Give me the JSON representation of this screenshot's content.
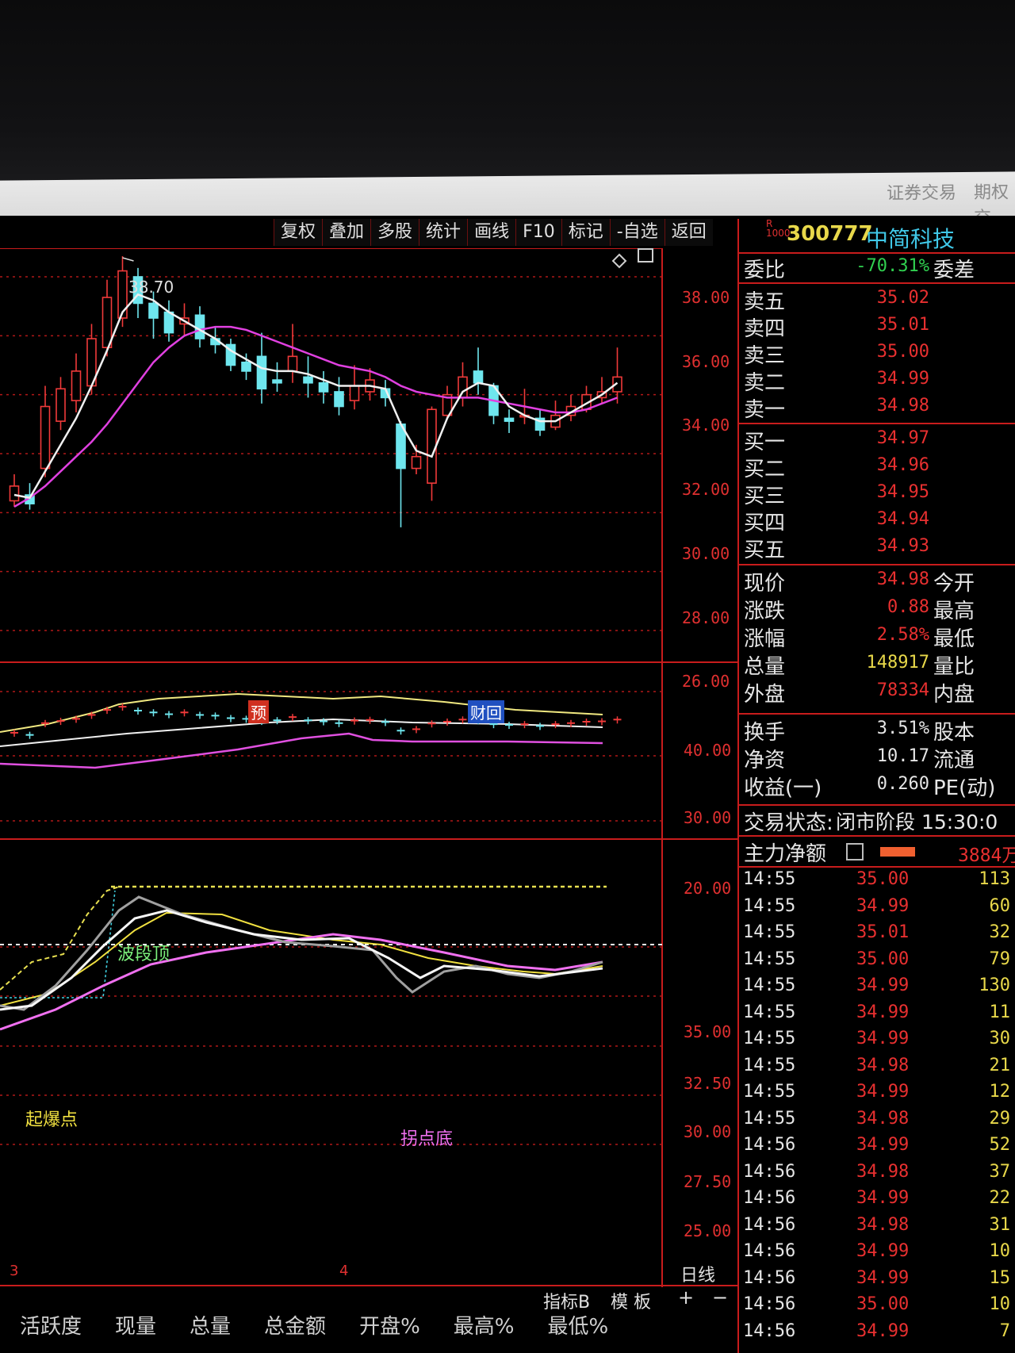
{
  "window_links": [
    "证券交易",
    "期权交"
  ],
  "toolbar": [
    "复权",
    "叠加",
    "多股",
    "统计",
    "画线",
    "F10",
    "标记",
    "-自选",
    "返回"
  ],
  "stock": {
    "badge": "R\n1000",
    "code": "300777",
    "name": "中简科技"
  },
  "weibi": {
    "label": "委比",
    "value": "-70.31%",
    "label2": "委差"
  },
  "asks": [
    {
      "label": "卖五",
      "price": "35.02"
    },
    {
      "label": "卖四",
      "price": "35.01"
    },
    {
      "label": "卖三",
      "price": "35.00"
    },
    {
      "label": "卖二",
      "price": "34.99"
    },
    {
      "label": "卖一",
      "price": "34.98"
    }
  ],
  "bids": [
    {
      "label": "买一",
      "price": "34.97"
    },
    {
      "label": "买二",
      "price": "34.96"
    },
    {
      "label": "买三",
      "price": "34.95"
    },
    {
      "label": "买四",
      "price": "34.94"
    },
    {
      "label": "买五",
      "price": "34.93"
    }
  ],
  "quote": [
    {
      "label": "现价",
      "value": "34.98",
      "label2": "今开"
    },
    {
      "label": "涨跌",
      "value": "0.88",
      "label2": "最高"
    },
    {
      "label": "涨幅",
      "value": "2.58%",
      "label2": "最低"
    },
    {
      "label": "总量",
      "value": "148917",
      "label2": "量比"
    },
    {
      "label": "外盘",
      "value": "78334",
      "label2": "内盘"
    }
  ],
  "stats": [
    {
      "label": "换手",
      "value": "3.51%",
      "label2": "股本"
    },
    {
      "label": "净资",
      "value": "10.17",
      "label2": "流通"
    },
    {
      "label": "收益(一)",
      "value": "0.260",
      "label2": "PE(动)"
    }
  ],
  "status": {
    "label": "交易状态:",
    "value": "闭市阶段 15:30:0"
  },
  "mainflow": {
    "label": "主力净额",
    "value": "3884万"
  },
  "ticks": [
    {
      "t": "14:55",
      "p": "35.00",
      "v": "113"
    },
    {
      "t": "14:55",
      "p": "34.99",
      "v": "60"
    },
    {
      "t": "14:55",
      "p": "35.01",
      "v": "32"
    },
    {
      "t": "14:55",
      "p": "35.00",
      "v": "79"
    },
    {
      "t": "14:55",
      "p": "34.99",
      "v": "130"
    },
    {
      "t": "14:55",
      "p": "34.99",
      "v": "11"
    },
    {
      "t": "14:55",
      "p": "34.99",
      "v": "30"
    },
    {
      "t": "14:55",
      "p": "34.98",
      "v": "21"
    },
    {
      "t": "14:55",
      "p": "34.99",
      "v": "12"
    },
    {
      "t": "14:55",
      "p": "34.98",
      "v": "29"
    },
    {
      "t": "14:56",
      "p": "34.99",
      "v": "52"
    },
    {
      "t": "14:56",
      "p": "34.98",
      "v": "37"
    },
    {
      "t": "14:56",
      "p": "34.99",
      "v": "22"
    },
    {
      "t": "14:56",
      "p": "34.98",
      "v": "31"
    },
    {
      "t": "14:56",
      "p": "34.99",
      "v": "10"
    },
    {
      "t": "14:56",
      "p": "34.99",
      "v": "15"
    },
    {
      "t": "14:56",
      "p": "35.00",
      "v": "10"
    },
    {
      "t": "14:56",
      "p": "34.99",
      "v": "7"
    }
  ],
  "chart_data": {
    "type": "candlestick",
    "price_axis": [
      "38.00",
      "36.00",
      "34.00",
      "32.00",
      "30.00",
      "28.00",
      "26.00"
    ],
    "peak_label": "38.70",
    "markers": [
      "预",
      "财回"
    ],
    "mid_axis": [
      "40.00",
      "30.00",
      "20.00"
    ],
    "lower_axis": [
      "35.00",
      "32.50",
      "30.00",
      "27.50",
      "25.00"
    ],
    "lower_labels": [
      "波段顶",
      "起爆点",
      "拐点底"
    ],
    "period_marks": [
      "3",
      "4"
    ],
    "period": "日线",
    "ylim": [
      26,
      39
    ],
    "candles": [
      {
        "o": 30.4,
        "c": 30.9,
        "h": 31.3,
        "l": 30.2
      },
      {
        "o": 30.6,
        "c": 30.3,
        "h": 31.0,
        "l": 30.1
      },
      {
        "o": 31.5,
        "c": 33.6,
        "h": 34.3,
        "l": 31.2
      },
      {
        "o": 33.1,
        "c": 34.2,
        "h": 34.6,
        "l": 32.8
      },
      {
        "o": 33.8,
        "c": 34.8,
        "h": 35.4,
        "l": 33.4
      },
      {
        "o": 34.3,
        "c": 35.9,
        "h": 36.4,
        "l": 34.0
      },
      {
        "o": 35.6,
        "c": 37.3,
        "h": 37.9,
        "l": 35.3
      },
      {
        "o": 36.6,
        "c": 38.2,
        "h": 38.7,
        "l": 36.3
      },
      {
        "o": 38.0,
        "c": 37.1,
        "h": 38.3,
        "l": 36.6
      },
      {
        "o": 37.1,
        "c": 36.6,
        "h": 37.5,
        "l": 35.9
      },
      {
        "o": 36.8,
        "c": 36.1,
        "h": 37.2,
        "l": 35.8
      },
      {
        "o": 36.4,
        "c": 36.6,
        "h": 37.1,
        "l": 36.0
      },
      {
        "o": 36.7,
        "c": 35.9,
        "h": 37.0,
        "l": 35.6
      },
      {
        "o": 35.9,
        "c": 35.7,
        "h": 36.3,
        "l": 35.4
      },
      {
        "o": 35.7,
        "c": 35.0,
        "h": 35.9,
        "l": 34.8
      },
      {
        "o": 35.1,
        "c": 34.8,
        "h": 35.4,
        "l": 34.5
      },
      {
        "o": 35.3,
        "c": 34.2,
        "h": 36.1,
        "l": 33.7
      },
      {
        "o": 34.5,
        "c": 34.4,
        "h": 35.1,
        "l": 34.1
      },
      {
        "o": 34.8,
        "c": 35.3,
        "h": 36.4,
        "l": 34.4
      },
      {
        "o": 34.6,
        "c": 34.4,
        "h": 35.3,
        "l": 33.9
      },
      {
        "o": 34.4,
        "c": 34.1,
        "h": 34.8,
        "l": 33.7
      },
      {
        "o": 34.1,
        "c": 33.6,
        "h": 34.6,
        "l": 33.3
      },
      {
        "o": 33.8,
        "c": 34.3,
        "h": 35.0,
        "l": 33.5
      },
      {
        "o": 34.1,
        "c": 34.5,
        "h": 34.9,
        "l": 33.8
      },
      {
        "o": 34.2,
        "c": 33.9,
        "h": 34.5,
        "l": 33.6
      },
      {
        "o": 33.0,
        "c": 31.5,
        "h": 33.1,
        "l": 29.5
      },
      {
        "o": 31.5,
        "c": 31.9,
        "h": 32.3,
        "l": 31.3
      },
      {
        "o": 31.0,
        "c": 33.5,
        "h": 33.6,
        "l": 30.4
      },
      {
        "o": 33.3,
        "c": 34.0,
        "h": 34.3,
        "l": 33.2
      },
      {
        "o": 33.9,
        "c": 34.6,
        "h": 35.1,
        "l": 33.6
      },
      {
        "o": 34.8,
        "c": 34.4,
        "h": 35.6,
        "l": 34.0
      },
      {
        "o": 34.3,
        "c": 33.3,
        "h": 34.4,
        "l": 33.0
      },
      {
        "o": 33.2,
        "c": 33.1,
        "h": 33.5,
        "l": 32.7
      },
      {
        "o": 33.3,
        "c": 33.3,
        "h": 34.2,
        "l": 33.0
      },
      {
        "o": 33.2,
        "c": 32.8,
        "h": 33.5,
        "l": 32.6
      },
      {
        "o": 32.9,
        "c": 33.3,
        "h": 33.8,
        "l": 32.8
      },
      {
        "o": 33.3,
        "c": 33.6,
        "h": 34.0,
        "l": 33.1
      },
      {
        "o": 33.5,
        "c": 34.0,
        "h": 34.3,
        "l": 33.4
      },
      {
        "o": 33.9,
        "c": 34.1,
        "h": 34.6,
        "l": 33.7
      },
      {
        "o": 34.1,
        "c": 34.6,
        "h": 35.6,
        "l": 33.7
      }
    ],
    "ma_short": [
      30.6,
      30.5,
      31.4,
      32.3,
      33.2,
      34.3,
      35.5,
      36.8,
      37.4,
      37.2,
      36.8,
      36.5,
      36.2,
      35.9,
      35.5,
      35.2,
      34.9,
      34.8,
      34.8,
      34.7,
      34.5,
      34.3,
      34.3,
      34.3,
      34.2,
      33.0,
      32.1,
      31.9,
      33.2,
      34.1,
      34.4,
      34.3,
      33.6,
      33.3,
      33.1,
      33.1,
      33.4,
      33.7,
      34.0,
      34.4
    ],
    "ma_long": [
      30.2,
      30.5,
      30.9,
      31.4,
      31.9,
      32.4,
      33.0,
      33.7,
      34.4,
      35.1,
      35.6,
      36.0,
      36.2,
      36.3,
      36.3,
      36.2,
      36.0,
      35.8,
      35.6,
      35.4,
      35.2,
      35.0,
      34.9,
      34.8,
      34.6,
      34.3,
      34.1,
      34.0,
      33.9,
      33.9,
      33.9,
      33.8,
      33.7,
      33.6,
      33.5,
      33.4,
      33.4,
      33.5,
      33.7,
      33.9
    ]
  }
}
